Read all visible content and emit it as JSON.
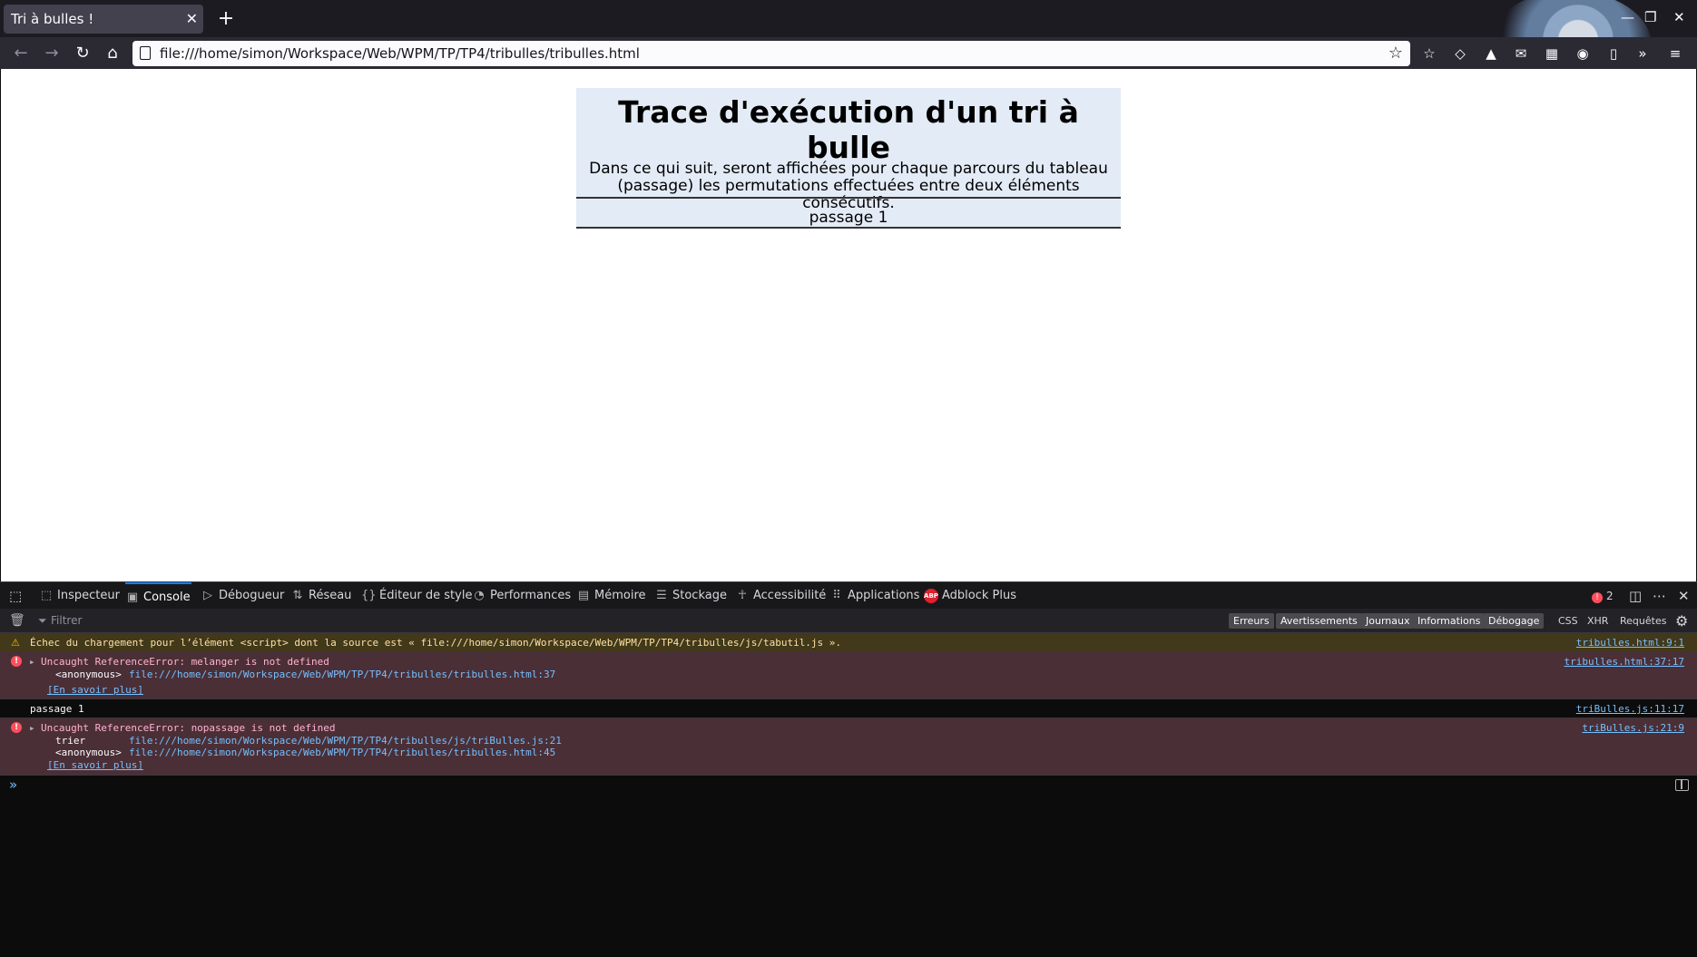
{
  "browser": {
    "tab_title": "Tri à bulles !",
    "tab_close": "✕",
    "new_tab": "+",
    "url": "file:///home/simon/Workspace/Web/WPM/TP/TP4/tribulles/tribulles.html",
    "back": "←",
    "forward": "→",
    "reload": "↻",
    "home": "⌂",
    "bookmark_star": "☆",
    "min": "—",
    "restore": "❐",
    "close": "✕",
    "menu": "≡",
    "overflow": "»"
  },
  "page": {
    "title": "Trace d'exécution d'un tri à bulle",
    "intro_line1": "Dans ce qui suit, seront affichées pour chaque parcours du tableau",
    "intro_line2": "(passage) les permutations effectuées entre deux éléments consécutifs.",
    "pass_label": "passage 1"
  },
  "devtools": {
    "tabs": [
      {
        "label": "Inspecteur",
        "icon": "⬚"
      },
      {
        "label": "Console",
        "icon": "▣"
      },
      {
        "label": "Débogueur",
        "icon": "▷"
      },
      {
        "label": "Réseau",
        "icon": "⇅"
      },
      {
        "label": "Éditeur de style",
        "icon": "{}"
      },
      {
        "label": "Performances",
        "icon": "◔"
      },
      {
        "label": "Mémoire",
        "icon": "▤"
      },
      {
        "label": "Stockage",
        "icon": "☰"
      },
      {
        "label": "Accessibilité",
        "icon": "☥"
      },
      {
        "label": "Applications",
        "icon": "⠿"
      },
      {
        "label": "Adblock Plus",
        "icon": "ABP"
      }
    ],
    "error_count": "2",
    "filter_placeholder": "Filtrer",
    "levels": [
      "Erreurs",
      "Avertissements",
      "Journaux",
      "Informations",
      "Débogage"
    ],
    "types": [
      "CSS",
      "XHR",
      "Requêtes"
    ],
    "messages": {
      "warn_text": "Échec du chargement pour l’élément <script> dont la source est « file:///home/simon/Workspace/Web/WPM/TP/TP4/tribulles/js/tabutil.js ».",
      "warn_src": "tribulles.html:9:1",
      "err1_text": "Uncaught ReferenceError: melanger is not defined",
      "err1_frame1_name": "<anonymous>",
      "err1_frame1_url": "file:///home/simon/Workspace/Web/WPM/TP/TP4/tribulles/tribulles.html:37",
      "err1_learn": "[En savoir plus]",
      "err1_src": "tribulles.html:37:17",
      "log_text": "passage 1",
      "log_src": "triBulles.js:11:17",
      "err2_text": "Uncaught ReferenceError: nopassage is not defined",
      "err2_frame1_name": "trier",
      "err2_frame1_url": "file:///home/simon/Workspace/Web/WPM/TP/TP4/tribulles/js/triBulles.js:21",
      "err2_frame2_name": "<anonymous>",
      "err2_frame2_url": "file:///home/simon/Workspace/Web/WPM/TP/TP4/tribulles/tribulles.html:45",
      "err2_learn": "[En savoir plus]",
      "err2_src": "triBulles.js:21:9"
    },
    "prompt": "»"
  }
}
